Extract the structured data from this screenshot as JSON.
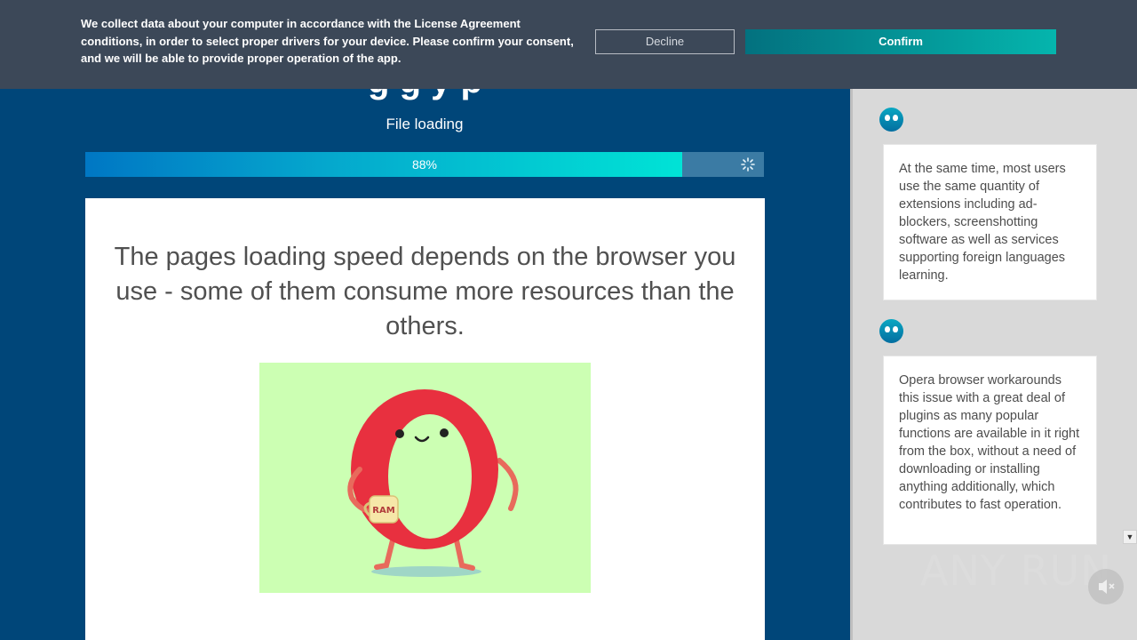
{
  "banner": {
    "message": "We collect data about your computer in accordance with the License Agreement conditions, in order to select proper drivers for your device. Please confirm your consent, and we will be able to provide proper operation of the app.",
    "decline_label": "Decline",
    "confirm_label": "Confirm"
  },
  "main": {
    "heading_partial": "g g y p",
    "file_loading_label": "File loading",
    "progress": {
      "value_fraction": 0.88,
      "label": "88%"
    },
    "card_title": "The pages loading speed depends on the browser you use - some of them consume more resources than the others.",
    "illustration": {
      "mug_text": "RAM"
    }
  },
  "side": {
    "messages": [
      {
        "text": "At the same time, most users use the same quantity of extensions including ad-blockers, screenshotting software as well as services supporting foreign languages learning."
      },
      {
        "text": "Opera browser workarounds this issue with a great deal of plugins as many popular functions are available in it right from the box, without a need of downloading or installing anything additionally, which contributes to fast operation."
      }
    ]
  },
  "watermark": {
    "text": "ANY RUN"
  },
  "colors": {
    "banner_bg": "#3c4858",
    "main_bg": "#004679",
    "accent": "#00c4d0",
    "illustration_bg": "#ccffb3",
    "opera_red": "#e8303f"
  }
}
